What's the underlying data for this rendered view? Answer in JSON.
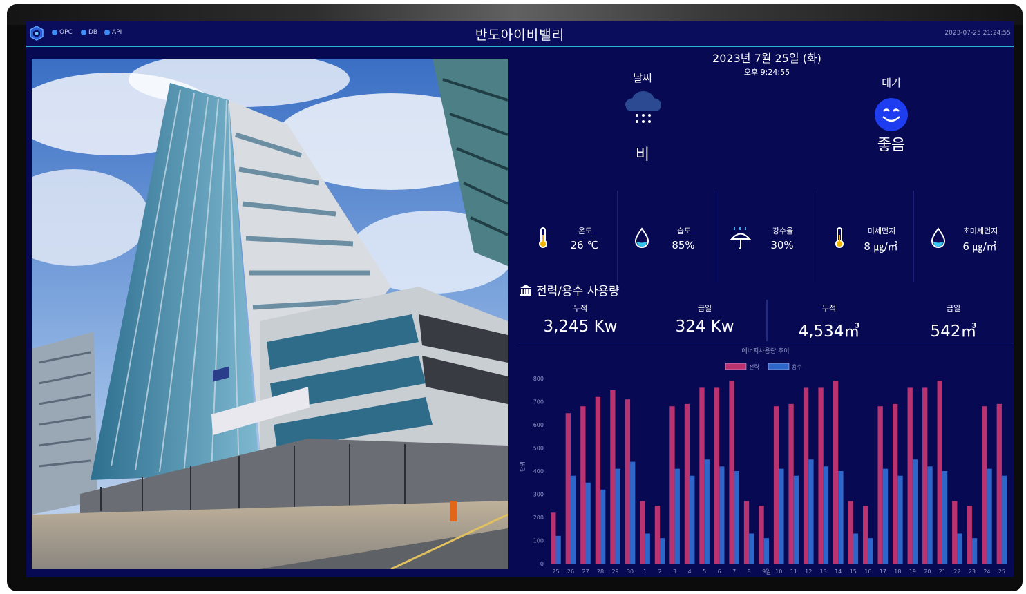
{
  "header": {
    "title": "반도아이비밸리",
    "status": [
      {
        "label": "OPC"
      },
      {
        "label": "DB"
      },
      {
        "label": "API"
      }
    ],
    "datetime": "2023-07-25 21:24:55"
  },
  "weather": {
    "date": "2023년 7월 25일 (화)",
    "time": "오후 9:24:55",
    "weather_label": "날씨",
    "weather_value": "비",
    "air_label": "대기",
    "air_value": "좋음"
  },
  "metrics": [
    {
      "label": "온도",
      "value": "26 ℃",
      "icon": "thermometer-icon"
    },
    {
      "label": "습도",
      "value": "85%",
      "icon": "water-drop-icon"
    },
    {
      "label": "강수율",
      "value": "30%",
      "icon": "umbrella-rain-icon"
    },
    {
      "label": "미세먼지",
      "value": "8 ㎍/㎥",
      "icon": "thermometer-icon"
    },
    {
      "label": "초미세먼지",
      "value": "6 ㎍/㎥",
      "icon": "water-drop-icon"
    }
  ],
  "usage": {
    "section_title": "전력/용수 사용량",
    "cols": [
      {
        "label": "누적",
        "value": "3,245 Kw"
      },
      {
        "label": "금일",
        "value": "324 Kw"
      },
      {
        "label": "누적",
        "value": "4,534㎥"
      },
      {
        "label": "금일",
        "value": "542㎥"
      }
    ]
  },
  "colors": {
    "power": "#b8336f",
    "water": "#2f66c9",
    "accent": "#2fb7d6",
    "background": "#070a52"
  },
  "chart_data": {
    "type": "bar",
    "title": "에너지사용량 추이",
    "xlabel": "일",
    "ylabel": "단위",
    "ylim": [
      0,
      800
    ],
    "yticks": [
      0,
      100,
      200,
      300,
      400,
      500,
      600,
      700,
      800
    ],
    "grid": false,
    "legend": "top-center",
    "categories": [
      "25",
      "26",
      "27",
      "28",
      "29",
      "30",
      "1",
      "2",
      "3",
      "4",
      "5",
      "6",
      "7",
      "8",
      "9",
      "10",
      "11",
      "12",
      "13",
      "14",
      "15",
      "16",
      "17",
      "18",
      "19",
      "20",
      "21",
      "22",
      "23",
      "24",
      "25"
    ],
    "series": [
      {
        "name": "전력",
        "color": "#b8336f",
        "values": [
          220,
          650,
          680,
          720,
          750,
          710,
          270,
          250,
          680,
          690,
          760,
          760,
          790,
          270,
          250,
          680,
          690,
          760,
          760,
          790,
          270,
          250,
          680,
          690,
          760,
          760,
          790,
          270,
          250,
          680,
          690
        ]
      },
      {
        "name": "용수",
        "color": "#2f66c9",
        "values": [
          120,
          380,
          350,
          320,
          410,
          440,
          130,
          110,
          410,
          380,
          450,
          420,
          400,
          130,
          110,
          410,
          380,
          450,
          420,
          400,
          130,
          110,
          410,
          380,
          450,
          420,
          400,
          130,
          110,
          410,
          380
        ]
      }
    ]
  }
}
